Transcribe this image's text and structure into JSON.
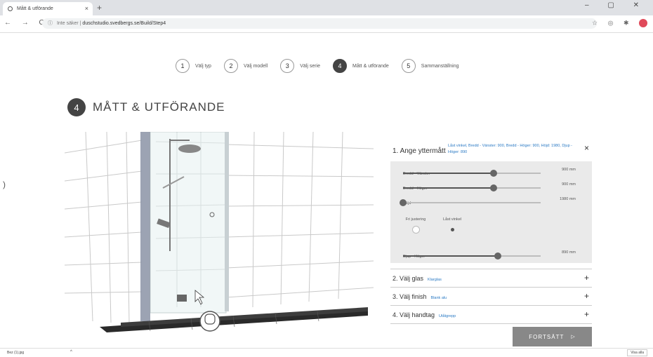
{
  "browser": {
    "tab_title": "Mått & utförande",
    "new_tab": "+",
    "window_controls": "– ▢ ✕",
    "nav": "← → C",
    "url_secure_label": "Inte säker",
    "url": "duschstudio.svedbergs.se/Build/Step4",
    "icons": [
      "refresh-icon",
      "info-icon",
      "star-icon",
      "extension-icon",
      "profile-icon"
    ]
  },
  "steps": [
    {
      "num": "1",
      "label": "Välj typ"
    },
    {
      "num": "2",
      "label": "Välj modell"
    },
    {
      "num": "3",
      "label": "Välj serie"
    },
    {
      "num": "4",
      "label": "Mått & utförande",
      "active": true
    },
    {
      "num": "5",
      "label": "Sammanställning"
    }
  ],
  "heading": {
    "num": "4",
    "title": "MÅTT & UTFÖRANDE"
  },
  "side_glyph": ")",
  "panel": {
    "title": "1. Ange yttermått",
    "summary": "Låst vinkel, Bredd - Vänster: 900, Bredd - Höger: 900, Höjd: 1980, Djup - Höger: 890",
    "close": "×",
    "sliders": [
      {
        "label": "Bredd - Vänster",
        "value": "900 mm",
        "fraction": 0.66
      },
      {
        "label": "Bredd - Höger",
        "value": "900 mm",
        "fraction": 0.66
      },
      {
        "label": "Höjd",
        "value": "1980 mm",
        "fraction": 0.0
      },
      {
        "label": "Djup - Höger",
        "value": "890 mm",
        "fraction": 0.69
      }
    ],
    "radios": [
      {
        "label": "Fri justering",
        "selected": false
      },
      {
        "label": "Låst vinkel",
        "selected": true
      }
    ],
    "sections": [
      {
        "title": "2. Välj glas",
        "value": "Klarglas"
      },
      {
        "title": "3. Välj finish",
        "value": "Blank alu"
      },
      {
        "title": "4. Välj handtag",
        "value": "Utåtgrepp"
      }
    ],
    "plus": "+",
    "cta": "FORTSÄTT",
    "cta_arrow": "▷"
  },
  "download_bar": {
    "file": "Bez (1).jpg",
    "chevron": "^",
    "show_all": "Visa alla"
  }
}
